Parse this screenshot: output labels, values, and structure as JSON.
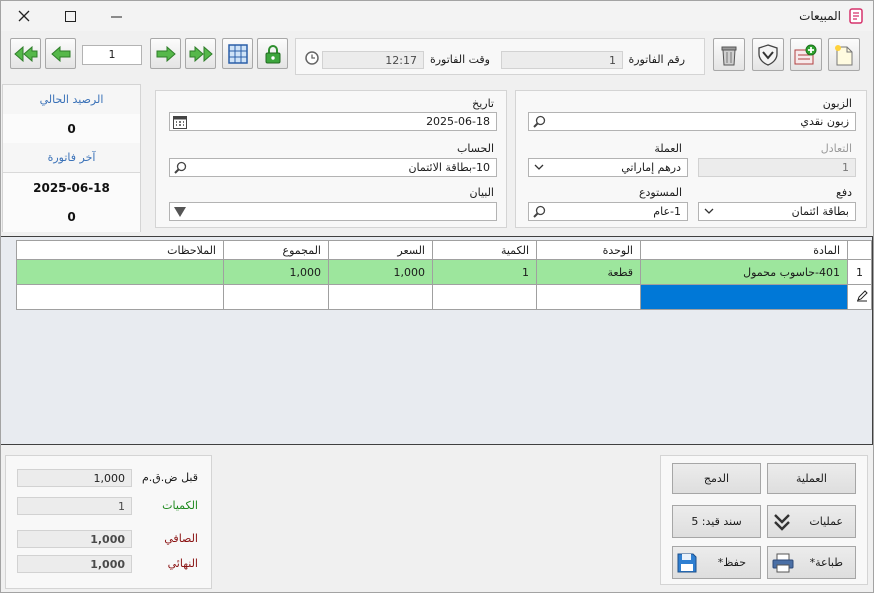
{
  "window": {
    "title": "المبيعات",
    "title_icon": "sales-document-icon"
  },
  "toolbar": {
    "record_number": "1",
    "invoice_time_label": "وقت الفاتورة",
    "invoice_time": "12:17",
    "invoice_number_label": "رقم الفاتورة",
    "invoice_number": "1",
    "icons": [
      "first-record-icon",
      "previous-record-icon",
      "next-record-icon",
      "last-record-icon",
      "grid-view-icon",
      "lock-icon",
      "clock-icon",
      "trash-icon",
      "shield-check-icon",
      "add-record-icon",
      "new-document-icon"
    ]
  },
  "summary": {
    "current_balance_label": "الرصيد الحالي",
    "current_balance": "0",
    "last_invoice_label": "آخر فاتورة",
    "last_invoice_date": "2025-06-18",
    "last_invoice_amount": "0"
  },
  "header_form": {
    "date_label": "تاريخ",
    "date": "2025-06-18",
    "account_label": "الحساب",
    "account": "10-بطاقة الائتمان",
    "statement_label": "البيان",
    "statement": "",
    "customer_label": "الزبون",
    "customer": "زبون نقدي",
    "exchange_rate_label": "التعادل",
    "exchange_rate": "1",
    "currency_label": "العملة",
    "currency": "درهم إماراتي",
    "payment_label": "دفع",
    "payment": "بطاقة ائتمان",
    "warehouse_label": "المستودع",
    "warehouse": "1-عام"
  },
  "grid": {
    "columns": {
      "item": "المادة",
      "unit": "الوحدة",
      "quantity": "الكمية",
      "price": "السعر",
      "total": "المجموع",
      "notes": "الملاحظات"
    },
    "rows": [
      {
        "row_number": "1",
        "item": "401-حاسوب محمول",
        "unit": "قطعة",
        "quantity": "1",
        "price": "1,000",
        "total": "1,000",
        "notes": ""
      }
    ]
  },
  "totals": {
    "before_vat_label": "قبل ض.ق.م",
    "before_vat": "1,000",
    "quantities_label": "الكميات",
    "quantities": "1",
    "net_label": "الصافي",
    "net": "1,000",
    "final_label": "النهائي",
    "final": "1,000"
  },
  "actions": {
    "operation": "العملية",
    "merge": "الدمج",
    "operations": "عمليات",
    "journal_voucher": "سند قيد: 5",
    "print": "طباعة*",
    "save": "حفظ*"
  },
  "colors": {
    "selected_row": "#9de69d",
    "selected_cell": "#0078d7",
    "label_blue": "#3b72b8",
    "label_green": "#1f8a1f",
    "label_red": "#8a1212"
  }
}
